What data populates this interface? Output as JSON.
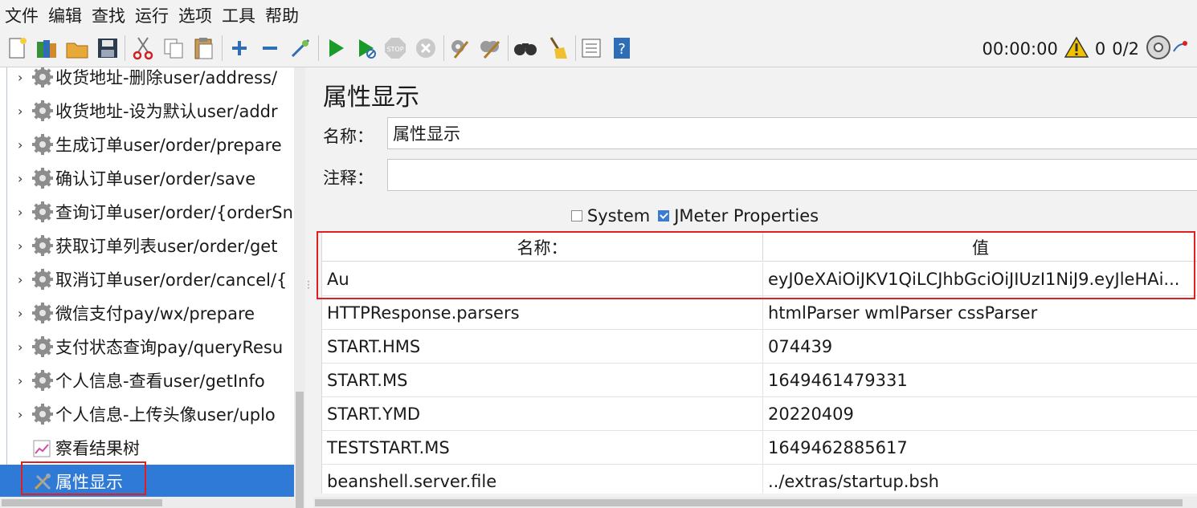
{
  "menu": [
    "文件",
    "编辑",
    "查找",
    "运行",
    "选项",
    "工具",
    "帮助"
  ],
  "toolbar_icons": [
    "new-icon",
    "templates-icon",
    "open-icon",
    "save-icon",
    "cut-icon",
    "copy-icon",
    "paste-icon",
    "expand-icon",
    "collapse-icon",
    "toggle-icon",
    "start-icon",
    "start-no-pause-icon",
    "stop-icon",
    "shutdown-icon",
    "clear-icon",
    "clear-all-icon",
    "search-icon",
    "reset-search-icon",
    "function-helper-icon",
    "help-icon"
  ],
  "status": {
    "timer": "00:00:00",
    "warnings": "0",
    "threads": "0/2"
  },
  "tree": {
    "items": [
      {
        "label": "收货地址-删除user/address/",
        "icon": "sampler-gear-icon"
      },
      {
        "label": "收货地址-设为默认user/addr",
        "icon": "sampler-gear-icon"
      },
      {
        "label": "生成订单user/order/prepare",
        "icon": "sampler-gear-icon"
      },
      {
        "label": "确认订单user/order/save",
        "icon": "sampler-gear-icon"
      },
      {
        "label": "查询订单user/order/{orderSn",
        "icon": "sampler-gear-icon"
      },
      {
        "label": "获取订单列表user/order/get",
        "icon": "sampler-gear-icon"
      },
      {
        "label": "取消订单user/order/cancel/{",
        "icon": "sampler-gear-icon"
      },
      {
        "label": "微信支付pay/wx/prepare",
        "icon": "sampler-gear-icon"
      },
      {
        "label": "支付状态查询pay/queryResu",
        "icon": "sampler-gear-icon"
      },
      {
        "label": "个人信息-查看user/getInfo",
        "icon": "sampler-gear-icon"
      },
      {
        "label": "个人信息-上传头像user/uplo",
        "icon": "sampler-gear-icon"
      },
      {
        "label": "察看结果树",
        "icon": "results-tree-icon"
      },
      {
        "label": "属性显示",
        "icon": "property-display-icon"
      }
    ]
  },
  "panel": {
    "title": "属性显示",
    "name_label": "名称：",
    "name_value": "属性显示",
    "comment_label": "注释：",
    "comment_value": "",
    "system_label": "System",
    "system_checked": false,
    "jmeter_label": "JMeter Properties",
    "jmeter_checked": true
  },
  "table": {
    "headers": [
      "名称：",
      "值"
    ],
    "rows": [
      [
        "Au",
        "eyJ0eXAiOiJKV1QiLCJhbGciOiJIUzI1NiJ9.eyJleHAi..."
      ],
      [
        "HTTPResponse.parsers",
        "htmlParser wmlParser cssParser"
      ],
      [
        "START.HMS",
        "074439"
      ],
      [
        "START.MS",
        "1649461479331"
      ],
      [
        "START.YMD",
        "20220409"
      ],
      [
        "TESTSTART.MS",
        "1649462885617"
      ],
      [
        "beanshell.server.file",
        "../extras/startup.bsh"
      ]
    ]
  },
  "colors": {
    "selection": "#2f7ad6",
    "highlight": "#e02020",
    "run": "#1a9a2a"
  }
}
